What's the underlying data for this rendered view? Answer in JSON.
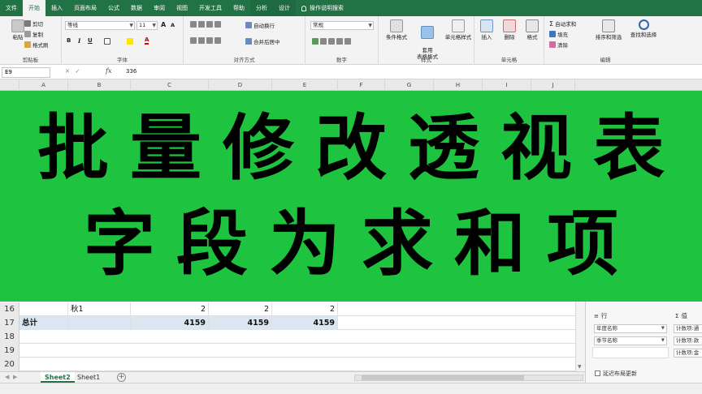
{
  "tabs": [
    "文件",
    "开始",
    "插入",
    "页面布局",
    "公式",
    "数据",
    "审阅",
    "视图",
    "开发工具",
    "帮助",
    "分析",
    "设计"
  ],
  "tell_me": "操作说明搜索",
  "ribbon": {
    "clipboard": {
      "paste": "粘贴",
      "cut": "剪切",
      "copy": "复制",
      "format_painter": "格式刷",
      "label": "剪贴板"
    },
    "font": {
      "name": "等线",
      "size": "11",
      "bold": "B",
      "italic": "I",
      "underline": "U",
      "grow": "A",
      "shrink": "A",
      "font_color": "A",
      "label": "字体"
    },
    "alignment": {
      "wrap": "自动换行",
      "merge": "合并后居中",
      "label": "对齐方式"
    },
    "number": {
      "format": "常规",
      "label": "数字"
    },
    "styles": {
      "cond": "条件格式",
      "table": "套用\n表格格式",
      "cell": "单元格样式",
      "label": "样式"
    },
    "cells": {
      "insert": "插入",
      "delete": "删除",
      "format": "格式",
      "label": "单元格"
    },
    "editing": {
      "autosum": "自动求和",
      "fill": "填充",
      "clear": "清除",
      "sort": "排序和筛选",
      "find": "查找和选择",
      "label": "编辑"
    }
  },
  "formula_bar": {
    "name_box": "E9",
    "fx": "fx",
    "value": "336"
  },
  "columns": [
    "A",
    "B",
    "C",
    "D",
    "E",
    "F",
    "G",
    "H",
    "I",
    "J"
  ],
  "grid_rows": [
    {
      "num": "16",
      "b": "秋1",
      "c": "2",
      "d": "2",
      "e": "2",
      "total": false
    },
    {
      "num": "17",
      "a": "总计",
      "c": "4159",
      "d": "4159",
      "e": "4159",
      "total": true
    },
    {
      "num": "18",
      "total": false
    },
    {
      "num": "19",
      "total": false
    },
    {
      "num": "20",
      "total": false
    }
  ],
  "sheet_tabs": [
    "Sheet2",
    "Sheet1"
  ],
  "pivot_pane": {
    "rows_label": "行",
    "values_label": "值",
    "row_fields": [
      "年度名称",
      "季节名称"
    ],
    "value_fields": [
      "计数项:通",
      "计数项:款",
      "计数项:金"
    ],
    "defer_update": "延迟布局更新"
  },
  "overlay": {
    "line1": "批量修改透视表",
    "line2": "字段为求和项"
  }
}
